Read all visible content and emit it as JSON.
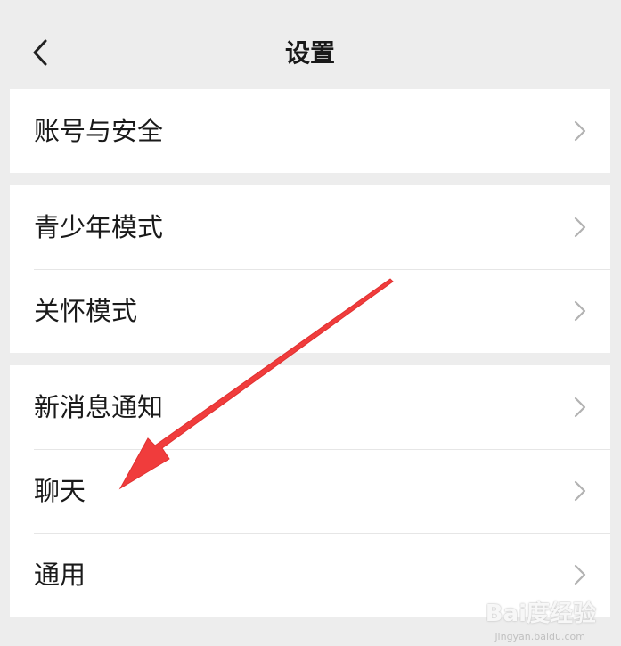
{
  "header": {
    "title": "设置",
    "back_icon": "chevron-left-icon"
  },
  "groups": [
    {
      "items": [
        {
          "label": "账号与安全"
        }
      ]
    },
    {
      "items": [
        {
          "label": "青少年模式"
        },
        {
          "label": "关怀模式"
        }
      ]
    },
    {
      "items": [
        {
          "label": "新消息通知"
        },
        {
          "label": "聊天"
        },
        {
          "label": "通用"
        }
      ]
    }
  ],
  "annotation": {
    "color": "#f03c3c"
  },
  "watermark": {
    "text": "Bai度经验",
    "sub": "jingyan.baidu.com"
  }
}
